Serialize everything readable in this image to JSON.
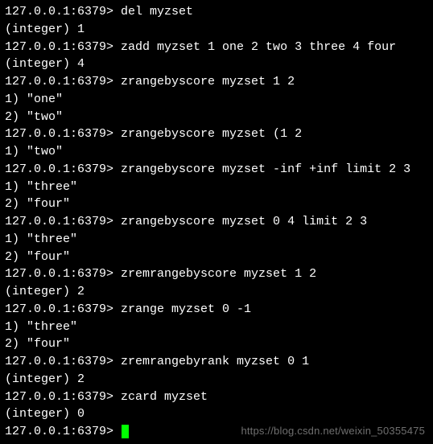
{
  "prompt": "127.0.0.1:6379> ",
  "entries": [
    {
      "type": "cmd",
      "command": "del myzset"
    },
    {
      "type": "out",
      "text": "(integer) 1"
    },
    {
      "type": "cmd",
      "command": "zadd myzset 1 one 2 two 3 three 4 four"
    },
    {
      "type": "out",
      "text": "(integer) 4"
    },
    {
      "type": "cmd",
      "command": "zrangebyscore myzset 1 2"
    },
    {
      "type": "out",
      "text": "1) \"one\""
    },
    {
      "type": "out",
      "text": "2) \"two\""
    },
    {
      "type": "cmd",
      "command": "zrangebyscore myzset (1 2"
    },
    {
      "type": "out",
      "text": "1) \"two\""
    },
    {
      "type": "cmd",
      "command": "zrangebyscore myzset -inf +inf limit 2 3"
    },
    {
      "type": "out",
      "text": "1) \"three\""
    },
    {
      "type": "out",
      "text": "2) \"four\""
    },
    {
      "type": "cmd",
      "command": "zrangebyscore myzset 0 4 limit 2 3"
    },
    {
      "type": "out",
      "text": "1) \"three\""
    },
    {
      "type": "out",
      "text": "2) \"four\""
    },
    {
      "type": "cmd",
      "command": "zremrangebyscore myzset 1 2"
    },
    {
      "type": "out",
      "text": "(integer) 2"
    },
    {
      "type": "cmd",
      "command": "zrange myzset 0 -1"
    },
    {
      "type": "out",
      "text": "1) \"three\""
    },
    {
      "type": "out",
      "text": "2) \"four\""
    },
    {
      "type": "cmd",
      "command": "zremrangebyrank myzset 0 1"
    },
    {
      "type": "out",
      "text": "(integer) 2"
    },
    {
      "type": "cmd",
      "command": "zcard myzset"
    },
    {
      "type": "out",
      "text": "(integer) 0"
    }
  ],
  "active_prompt": "127.0.0.1:6379> ",
  "watermark": "https://blog.csdn.net/weixin_50355475"
}
